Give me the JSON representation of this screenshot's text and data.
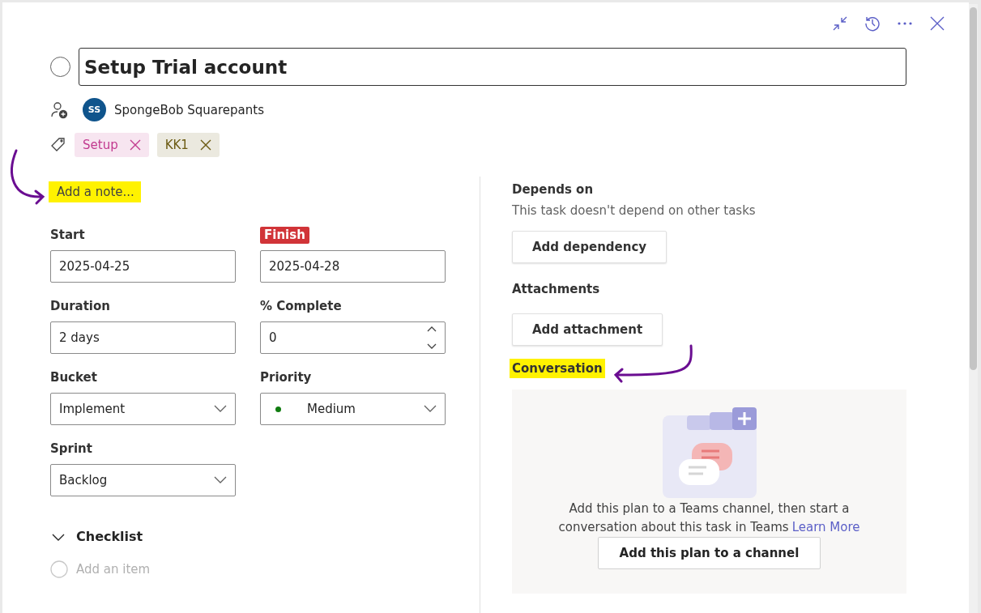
{
  "task": {
    "title": "Setup Trial account",
    "completed": false
  },
  "assignees": [
    {
      "initials": "SS",
      "name": "SpongeBob Squarepants"
    }
  ],
  "labels": [
    {
      "name": "Setup",
      "color": "#c23a8f"
    },
    {
      "name": "KK1",
      "color": "#6b5a12"
    }
  ],
  "note": {
    "placeholder": "Add a note...",
    "highlighted": true
  },
  "fields": [
    {
      "kind": "date",
      "label": "Start",
      "value": "2025-04-25",
      "alert": false
    },
    {
      "kind": "date",
      "label": "Finish",
      "value": "2025-04-28",
      "alert": true
    },
    {
      "kind": "text",
      "label": "Duration",
      "value": "2 days",
      "alert": false
    },
    {
      "kind": "number",
      "label": "% Complete",
      "value": "0",
      "alert": false
    },
    {
      "kind": "select",
      "label": "Bucket",
      "value": "Implement",
      "alert": false
    },
    {
      "kind": "select",
      "label": "Priority",
      "value": "Medium",
      "alert": false,
      "color": "#107c10"
    },
    {
      "kind": "select",
      "label": "Sprint",
      "value": "Backlog",
      "alert": false
    }
  ],
  "checklist": {
    "title": "Checklist",
    "expanded": true,
    "placeholder": "Add an item"
  },
  "depends_on": {
    "title": "Depends on",
    "text": "This task doesn't depend on other tasks",
    "button": "Add dependency"
  },
  "attachments": {
    "title": "Attachments",
    "button": "Add attachment"
  },
  "conversation": {
    "title": "Conversation",
    "highlighted": true,
    "message": "Add this plan to a Teams channel, then start a conversation about this task in Teams",
    "link": "Learn More",
    "button": "Add this plan to a channel"
  }
}
